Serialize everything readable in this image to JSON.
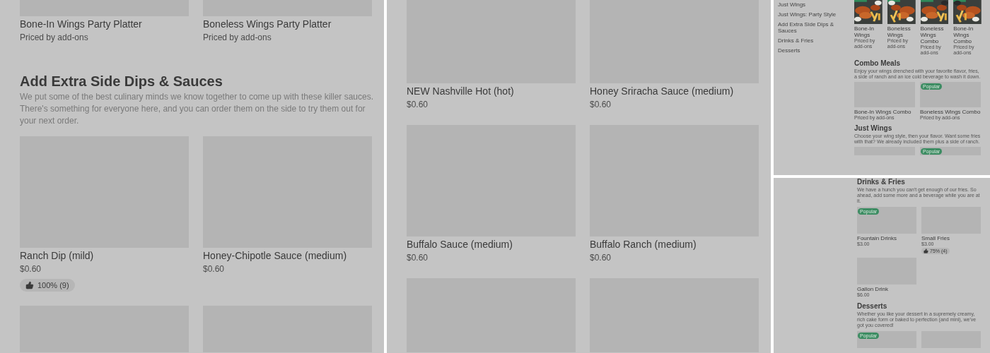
{
  "panels": [
    {
      "blocks": [
        {
          "kind": "row",
          "items": [
            {
              "kind": "placeholder",
              "name": "Bone-In Wings Party Platter",
              "price": "Priced by add-ons"
            },
            {
              "kind": "placeholder",
              "name": "Boneless Wings Party Platter",
              "price": "Priced by add-ons"
            }
          ]
        },
        {
          "kind": "heading",
          "title": "Add Extra Side Dips & Sauces",
          "description": "We put some of the best culinary minds we know together to come up with these killer sauces. There's something for everyone here, and you can order them on the side to try them out for your next order."
        },
        {
          "kind": "row",
          "items": [
            {
              "kind": "placeholder",
              "name": "Ranch Dip (mild)",
              "price": "$0.60",
              "rating": "100% (9)"
            },
            {
              "kind": "placeholder",
              "name": "Honey-Chipotle Sauce (medium)",
              "price": "$0.60"
            }
          ]
        },
        {
          "kind": "row",
          "items": [
            {
              "kind": "placeholder"
            },
            {
              "kind": "placeholder"
            }
          ]
        }
      ]
    },
    {
      "blocks": [
        {
          "kind": "row",
          "items": [
            {
              "kind": "placeholder",
              "name": "NEW Nashville Hot (hot)",
              "price": "$0.60"
            },
            {
              "kind": "placeholder",
              "name": "Honey Sriracha Sauce (medium)",
              "price": "$0.60"
            }
          ]
        },
        {
          "kind": "row",
          "items": [
            {
              "kind": "placeholder",
              "name": "Buffalo Sauce (medium)",
              "price": "$0.60"
            },
            {
              "kind": "placeholder",
              "name": "Buffalo Ranch (medium)",
              "price": "$0.60"
            }
          ]
        },
        {
          "kind": "row",
          "items": [
            {
              "kind": "placeholder"
            },
            {
              "kind": "placeholder"
            }
          ]
        }
      ]
    },
    {
      "nav": [
        "Just Wings",
        "Just Wings: Party Style",
        "Add Extra Side Dips & Sauces",
        "Drinks & Fries",
        "Desserts"
      ],
      "blocks": [
        {
          "kind": "row",
          "items": [
            {
              "name": "Bone-In Wings",
              "price": "Priced by add-ons"
            },
            {
              "name": "Boneless Wings",
              "price": "Priced by add-ons"
            },
            {
              "name": "Boneless Wings Combo",
              "price": "Priced by add-ons"
            },
            {
              "name": "Bone-In Wings Combo",
              "price": "Priced by add-ons"
            }
          ]
        },
        {
          "kind": "heading",
          "title": "Combo Meals",
          "description": "Enjoy your wings drenched with your favorite flavor, fries, a side of ranch and an ice cold beverage to wash it down."
        },
        {
          "kind": "row",
          "items": [
            {
              "kind": "placeholder",
              "name": "Bone-In Wings Combo",
              "price": "Priced by add-ons"
            },
            {
              "kind": "placeholder",
              "name": "Boneless Wings Combo",
              "price": "Priced by add-ons",
              "badge": "Popular"
            }
          ]
        },
        {
          "kind": "heading",
          "title": "Just Wings",
          "description": "Choose your wing style, then your flavor. Want some fries with that? We already included them plus a side of ranch."
        },
        {
          "kind": "row",
          "items": [
            {
              "kind": "placeholder"
            },
            {
              "kind": "placeholder",
              "badge": "Popular"
            }
          ]
        }
      ]
    },
    {
      "blocks": [
        {
          "kind": "heading",
          "title": "Drinks & Fries",
          "description": "We have a hunch you can't get enough of our fries. So ahead, add some more and a beverage while you are at it."
        },
        {
          "kind": "row",
          "items": [
            {
              "kind": "placeholder",
              "name": "Fountain Drinks",
              "price": "$3.00",
              "badge": "Popular"
            },
            {
              "kind": "placeholder",
              "name": "Small Fries",
              "price": "$3.00",
              "rating": "75% (4)"
            }
          ]
        },
        {
          "kind": "row",
          "items": [
            {
              "kind": "placeholder",
              "name": "Gallon Drink",
              "price": "$6.00"
            }
          ]
        },
        {
          "kind": "heading",
          "title": "Desserts",
          "description": "Whether you like your dessert in a supremely creamy, rich cake form or baked to perfection (and mini), we've got you covered!"
        },
        {
          "kind": "row",
          "items": [
            {
              "kind": "placeholder",
              "badge": "Popular"
            },
            {
              "kind": "placeholder"
            }
          ]
        }
      ]
    }
  ]
}
